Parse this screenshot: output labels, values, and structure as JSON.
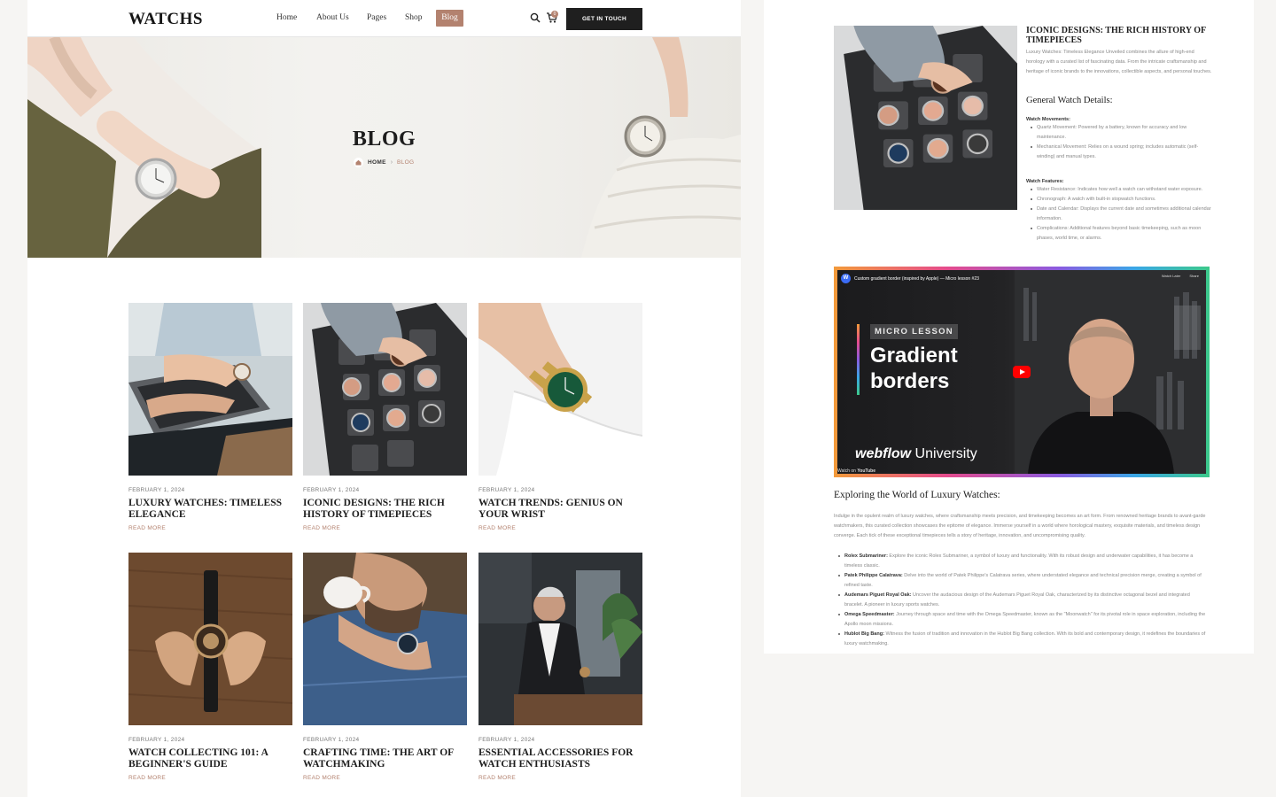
{
  "nav": {
    "logo": "WATCHS",
    "items": [
      "Home",
      "About Us",
      "Pages",
      "Shop"
    ],
    "active": "Blog",
    "cart_count": "0",
    "cta": "GET IN TOUCH"
  },
  "hero": {
    "title": "BLOG",
    "crumb_home": "HOME",
    "crumb_current": "BLOG"
  },
  "posts": [
    {
      "date": "FEBRUARY 1, 2024",
      "title": "LUXURY WATCHES: TIMELESS ELEGANCE",
      "more": "READ MORE"
    },
    {
      "date": "FEBRUARY 1, 2024",
      "title": "ICONIC DESIGNS: THE RICH HISTORY OF TIMEPIECES",
      "more": "READ MORE"
    },
    {
      "date": "FEBRUARY 1, 2024",
      "title": "WATCH TRENDS: GENIUS ON YOUR WRIST",
      "more": "READ MORE"
    },
    {
      "date": "FEBRUARY 1, 2024",
      "title": "WATCH COLLECTING 101: A BEGINNER'S GUIDE",
      "more": "READ MORE"
    },
    {
      "date": "FEBRUARY 1, 2024",
      "title": "CRAFTING TIME: THE ART OF WATCHMAKING",
      "more": "READ MORE"
    },
    {
      "date": "FEBRUARY 1, 2024",
      "title": "ESSENTIAL ACCESSORIES FOR WATCH ENTHUSIASTS",
      "more": "READ MORE"
    }
  ],
  "detail": {
    "title": "ICONIC DESIGNS: THE RICH HISTORY OF TIMEPIECES",
    "intro": "Luxury Watches: Timeless Elegance Unveiled combines the allure of high-end horology with a curated list of fascinating data. From the intricate craftsmanship and heritage of iconic brands to the innovations, collectible aspects, and personal touches.",
    "details_title": "General Watch Details:",
    "movements_title": "Watch Movements:",
    "movements": [
      "Quartz Movement: Powered by a battery, known for accuracy and low maintenance.",
      "Mechanical Movement: Relies on a wound spring; includes automatic (self-winding) and manual types."
    ],
    "features_title": "Watch Features:",
    "features": [
      "Water Resistance: Indicates how well a watch can withstand water exposure.",
      "Chronograph: A watch with built-in stopwatch functions.",
      "Date and Calendar: Displays the current date and sometimes additional calendar information.",
      "Complications: Additional features beyond basic timekeeping, such as moon phases, world time, or alarms."
    ],
    "video": {
      "channel_title": "Custom gradient border (inspired by Apple) — Micro lesson #23",
      "watch_later": "Watch Later",
      "share": "Share",
      "badge": "MICRO LESSON",
      "headline_1": "Gradient",
      "headline_2": "borders",
      "brand_bold": "webflow",
      "brand_rest": " University",
      "watch_on": "Watch on",
      "youtube": "YouTube"
    },
    "explore_title": "Exploring the World of Luxury Watches:",
    "explore_body": "Indulge in the opulent realm of luxury watches, where craftsmanship meets precision, and timekeeping becomes an art form. From renowned heritage brands to avant-garde watchmakers, this curated collection showcases the epitome of elegance. Immerse yourself in a world where horological mastery, exquisite materials, and timeless design converge. Each tick of these exceptional timepieces tells a story of heritage, innovation, and uncompromising quality.",
    "brands": [
      {
        "name": "Rolex Submariner:",
        "text": " Explore the iconic Rolex Submariner, a symbol of luxury and functionality. With its robust design and underwater capabilities, it has become a timeless classic."
      },
      {
        "name": "Patek Philippe Calatrava:",
        "text": " Delve into the world of Patek Philippe's Calatrava series, where understated elegance and technical precision merge, creating a symbol of refined taste."
      },
      {
        "name": "Audemars Piguet Royal Oak:",
        "text": " Uncover the audacious design of the Audemars Piguet Royal Oak, characterized by its distinctive octagonal bezel and integrated bracelet. A pioneer in luxury sports watches."
      },
      {
        "name": "Omega Speedmaster:",
        "text": " Journey through space and time with the Omega Speedmaster, known as the \"Moonwatch\" for its pivotal role in space exploration, including the Apollo moon missions."
      },
      {
        "name": "Hublot Big Bang:",
        "text": " Witness the fusion of tradition and innovation in the Hublot Big Bang collection. With its bold and contemporary design, it redefines the boundaries of luxury watchmaking."
      }
    ]
  },
  "colors": {
    "accent": "#b3826f",
    "dark": "#1f1f1f",
    "page_bg": "#f6f5f3"
  }
}
